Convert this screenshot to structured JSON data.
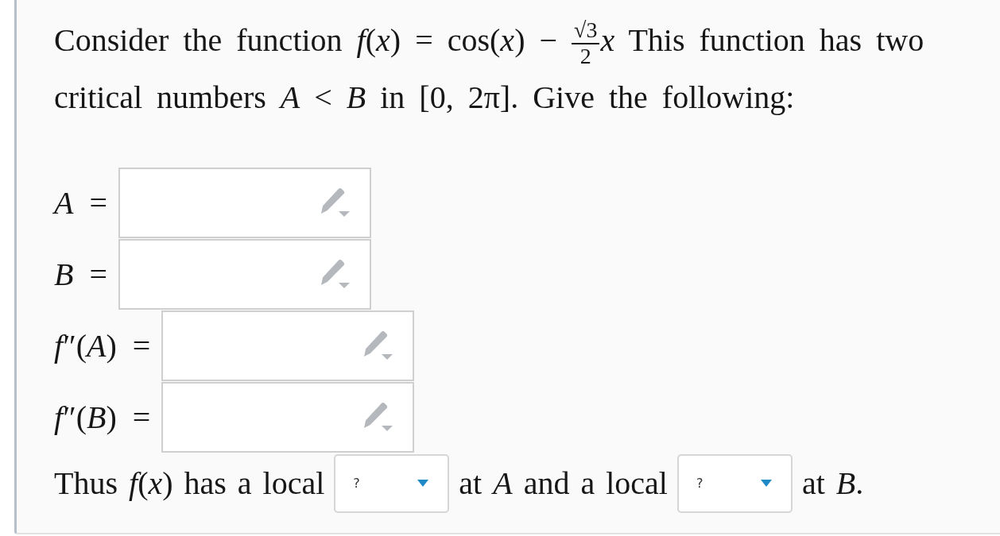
{
  "question": {
    "before": "Consider the function *f*(*x*) = cos(*x*) −",
    "fraction": {
      "numerator": "√3",
      "denominator": "2"
    },
    "after": "*x* This function has two critical numbers *A* < *B* in [0, 2π]. Give the following:"
  },
  "answers": [
    {
      "label": "*A* ="
    },
    {
      "label": "*B* ="
    },
    {
      "label": "*f*″(*A*) ="
    },
    {
      "label": "*f*″(*B*) ="
    }
  ],
  "conclusion": [
    {
      "kind": "text",
      "text": "Thus *f*(*x*) has a local"
    },
    {
      "kind": "select",
      "value": "?"
    },
    {
      "kind": "text",
      "text": "at *A* and a local"
    },
    {
      "kind": "select",
      "value": "?"
    },
    {
      "kind": "text",
      "text": "at *B*."
    }
  ]
}
